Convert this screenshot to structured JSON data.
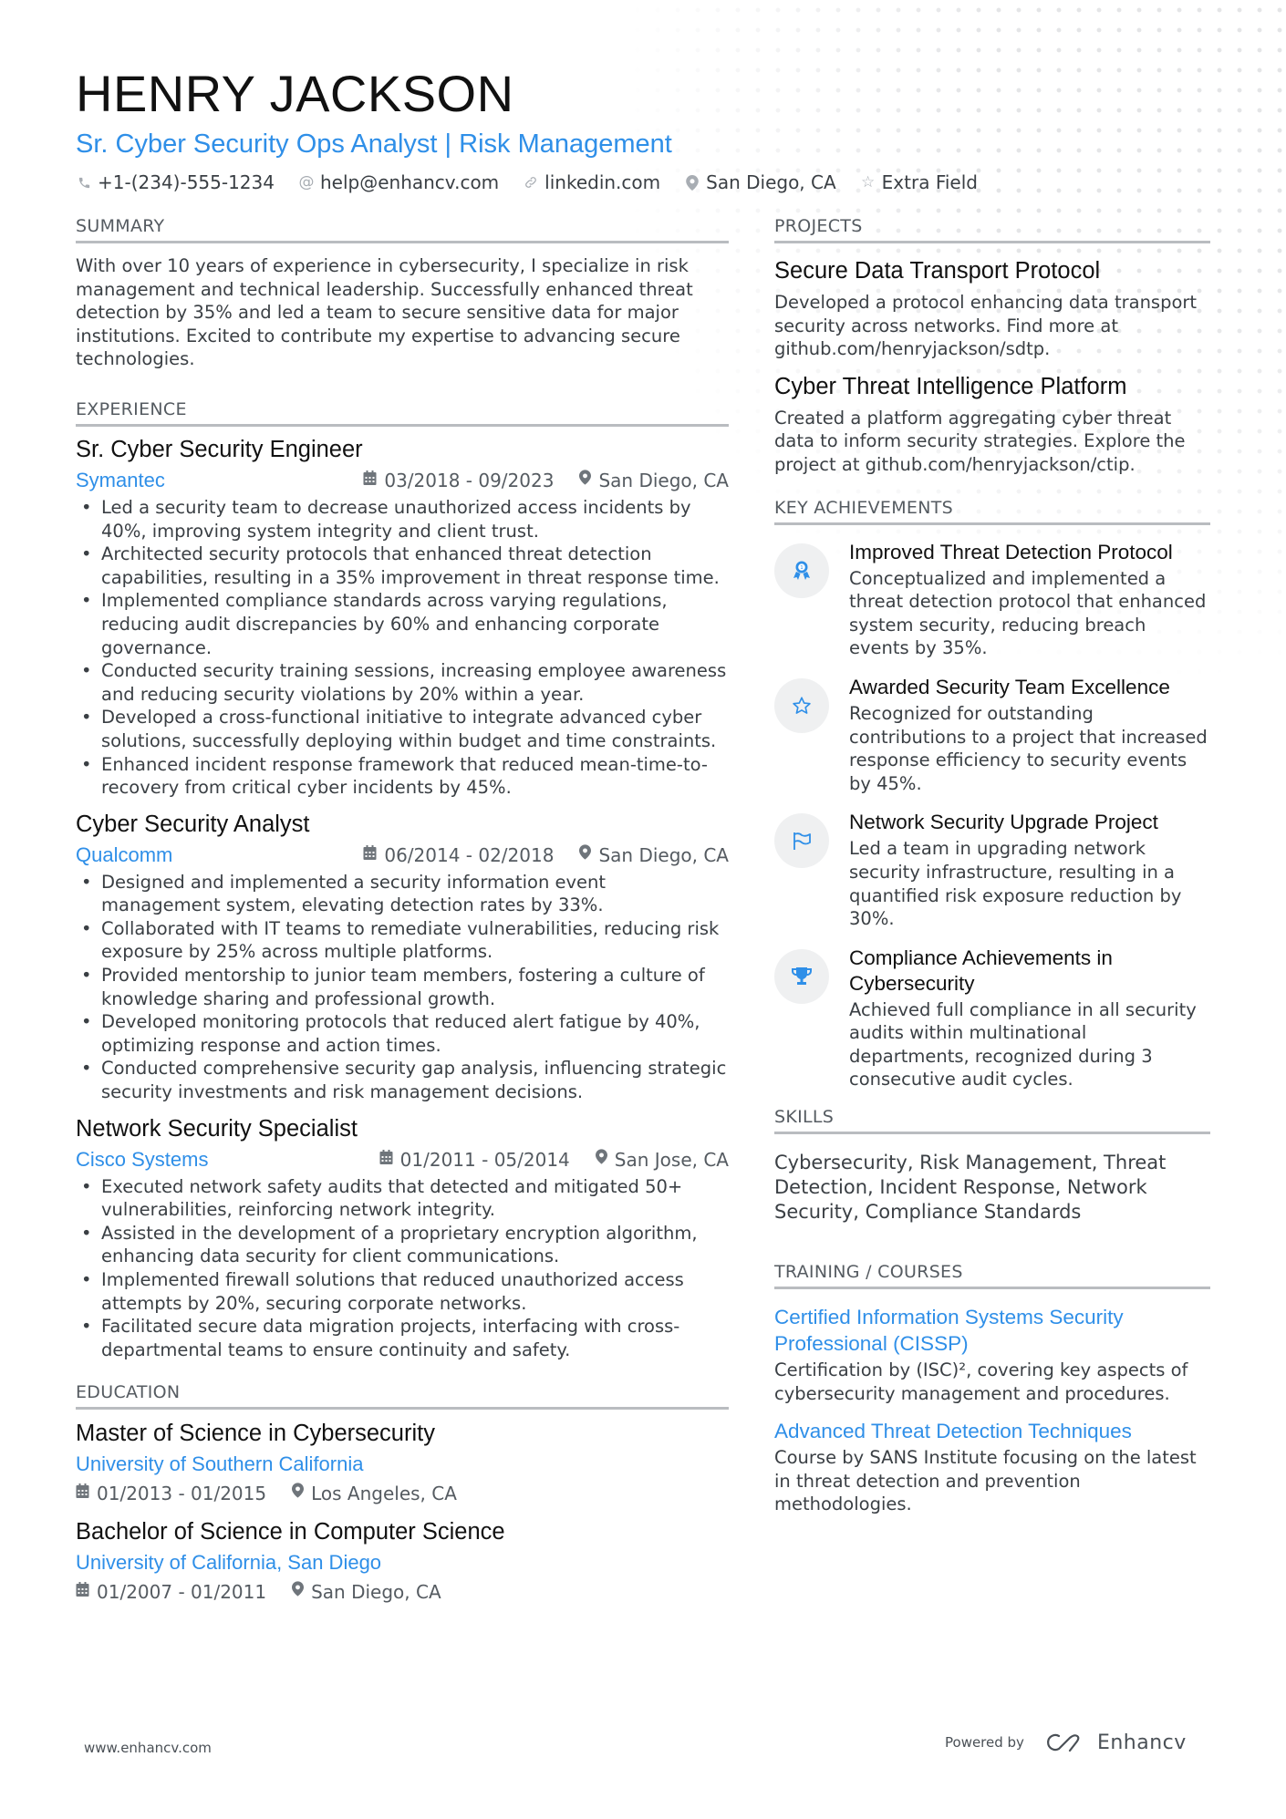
{
  "header": {
    "name": "HENRY JACKSON",
    "title": "Sr. Cyber Security Ops Analyst | Risk Management",
    "contacts": [
      {
        "icon": "phone-icon",
        "value": "+1-(234)-555-1234"
      },
      {
        "icon": "at-icon",
        "value": "help@enhancv.com"
      },
      {
        "icon": "link-icon",
        "value": "linkedin.com"
      },
      {
        "icon": "location-icon",
        "value": "San Diego, CA"
      },
      {
        "icon": "star-icon",
        "value": "Extra Field"
      }
    ]
  },
  "summary": {
    "heading": "SUMMARY",
    "text": "With over 10 years of experience in cybersecurity, I specialize in risk management and technical leadership. Successfully enhanced threat detection by 35% and led a team to secure sensitive data for major institutions. Excited to contribute my expertise to advancing secure technologies."
  },
  "experience": {
    "heading": "EXPERIENCE",
    "jobs": [
      {
        "title": "Sr. Cyber Security Engineer",
        "company": "Symantec",
        "dates": "03/2018 - 09/2023",
        "location": "San Diego, CA",
        "bullets": [
          "Led a security team to decrease unauthorized access incidents by 40%, improving system integrity and client trust.",
          "Architected security protocols that enhanced threat detection capabilities, resulting in a 35% improvement in threat response time.",
          "Implemented compliance standards across varying regulations, reducing audit discrepancies by 60% and enhancing corporate governance.",
          "Conducted security training sessions, increasing employee awareness and reducing security violations by 20% within a year.",
          "Developed a cross-functional initiative to integrate advanced cyber solutions, successfully deploying within budget and time constraints.",
          "Enhanced incident response framework that reduced mean-time-to-recovery from critical cyber incidents by 45%."
        ]
      },
      {
        "title": "Cyber Security Analyst",
        "company": "Qualcomm",
        "dates": "06/2014 - 02/2018",
        "location": "San Diego, CA",
        "bullets": [
          "Designed and implemented a security information event management system, elevating detection rates by 33%.",
          "Collaborated with IT teams to remediate vulnerabilities, reducing risk exposure by 25% across multiple platforms.",
          "Provided mentorship to junior team members, fostering a culture of knowledge sharing and professional growth.",
          "Developed monitoring protocols that reduced alert fatigue by 40%, optimizing response and action times.",
          "Conducted comprehensive security gap analysis, influencing strategic security investments and risk management decisions."
        ]
      },
      {
        "title": "Network Security Specialist",
        "company": "Cisco Systems",
        "dates": "01/2011 - 05/2014",
        "location": "San Jose, CA",
        "bullets": [
          "Executed network safety audits that detected and mitigated 50+ vulnerabilities, reinforcing network integrity.",
          "Assisted in the development of a proprietary encryption algorithm, enhancing data security for client communications.",
          "Implemented firewall solutions that reduced unauthorized access attempts by 20%, securing corporate networks.",
          "Facilitated secure data migration projects, interfacing with cross-departmental teams to ensure continuity and safety."
        ]
      }
    ]
  },
  "education": {
    "heading": "EDUCATION",
    "items": [
      {
        "degree": "Master of Science in Cybersecurity",
        "school": "University of Southern California",
        "dates": "01/2013 - 01/2015",
        "location": "Los Angeles, CA"
      },
      {
        "degree": "Bachelor of Science in Computer Science",
        "school": "University of California, San Diego",
        "dates": "01/2007 - 01/2011",
        "location": "San Diego, CA"
      }
    ]
  },
  "projects": {
    "heading": "PROJECTS",
    "items": [
      {
        "title": "Secure Data Transport Protocol",
        "description": "Developed a protocol enhancing data transport security across networks. Find more at github.com/henryjackson/sdtp."
      },
      {
        "title": "Cyber Threat Intelligence Platform",
        "description": "Created a platform aggregating cyber threat data to inform security strategies. Explore the project at github.com/henryjackson/ctip."
      }
    ]
  },
  "achievements": {
    "heading": "KEY ACHIEVEMENTS",
    "items": [
      {
        "icon": "award-medal-icon",
        "title": "Improved Threat Detection Protocol",
        "description": "Conceptualized and implemented a threat detection protocol that enhanced system security, reducing breach events by 35%."
      },
      {
        "icon": "star-icon",
        "title": "Awarded Security Team Excellence",
        "description": "Recognized for outstanding contributions to a project that increased response efficiency to security events by 45%."
      },
      {
        "icon": "flag-icon",
        "title": "Network Security Upgrade Project",
        "description": "Led a team in upgrading network security infrastructure, resulting in a quantified risk exposure reduction by 30%."
      },
      {
        "icon": "trophy-icon",
        "title": "Compliance Achievements in Cybersecurity",
        "description": "Achieved full compliance in all security audits within multinational departments, recognized during 3 consecutive audit cycles."
      }
    ]
  },
  "skills": {
    "heading": "SKILLS",
    "text": "Cybersecurity, Risk Management, Threat Detection, Incident Response, Network Security, Compliance Standards"
  },
  "training": {
    "heading": "TRAINING / COURSES",
    "items": [
      {
        "title": "Certified Information Systems Security Professional (CISSP)",
        "description": "Certification by (ISC)², covering key aspects of cybersecurity management and procedures."
      },
      {
        "title": "Advanced Threat Detection Techniques",
        "description": "Course by SANS Institute focusing on the latest in threat detection and prevention methodologies."
      }
    ]
  },
  "footer": {
    "website": "www.enhancv.com",
    "powered_by": "Powered by",
    "brand": "Enhancv"
  },
  "colors": {
    "accent": "#2f8fe8",
    "text": "#3a3f44",
    "heading": "#111111",
    "rule": "#b9bcc0",
    "icon_bg": "#eff0f1"
  }
}
